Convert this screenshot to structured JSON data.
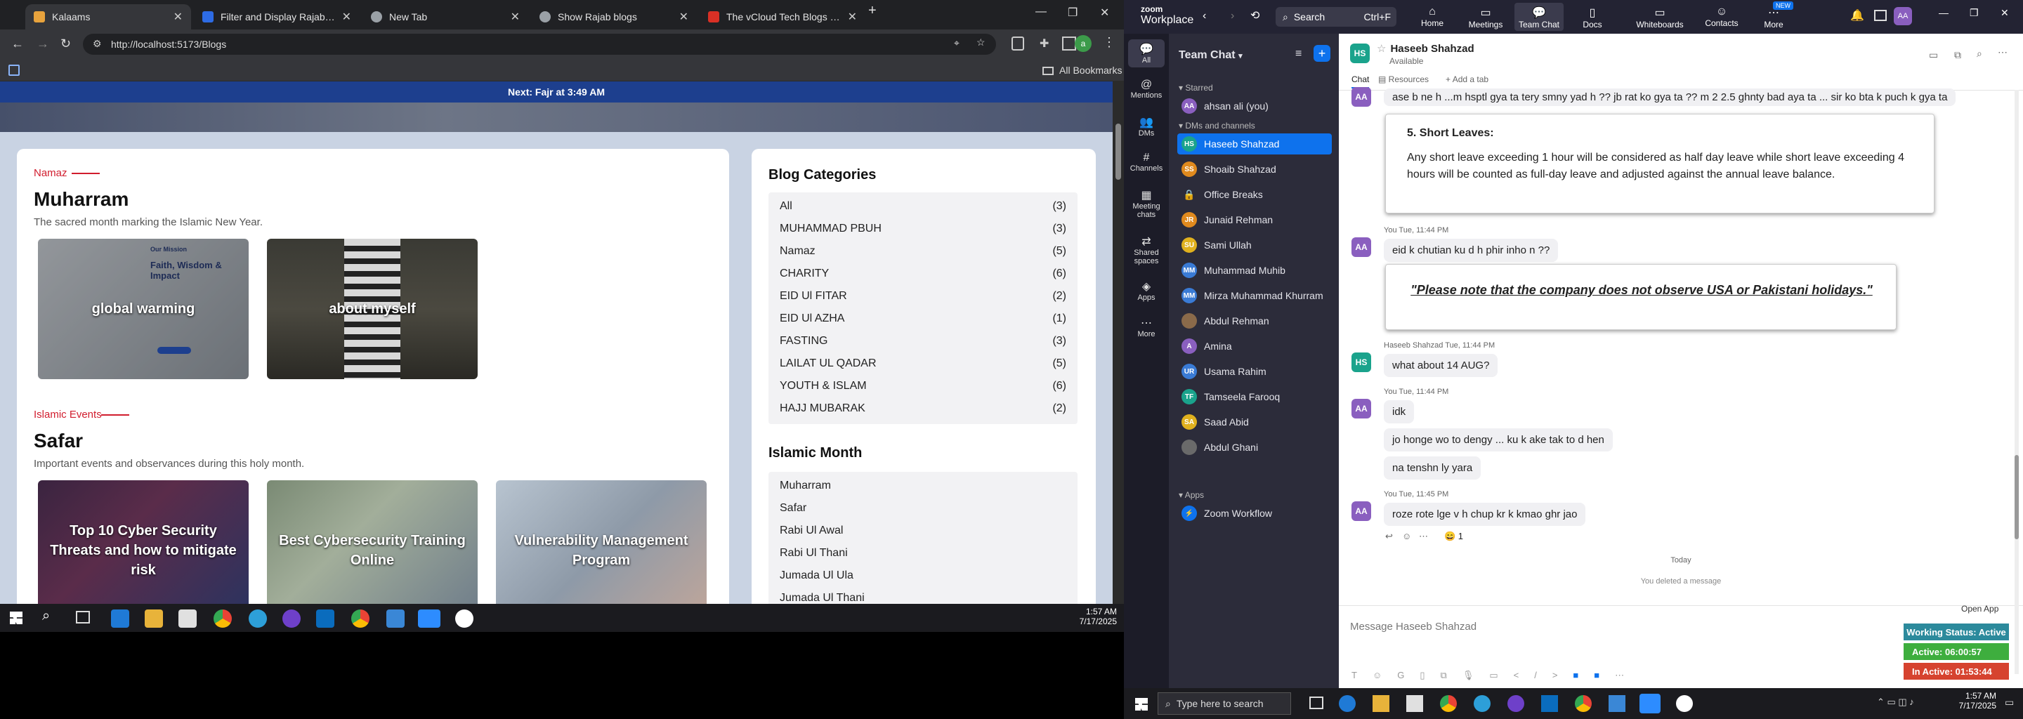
{
  "browser": {
    "tabs": [
      {
        "title": "Kalaams",
        "color": "#e8a33d",
        "active": true
      },
      {
        "title": "Filter and Display Rajab Blog Im",
        "color": "#2d6be4",
        "active": false
      },
      {
        "title": "New Tab",
        "color": "#9aa0a6",
        "active": false
      },
      {
        "title": "Show Rajab blogs",
        "color": "#9aa0a6",
        "active": false
      },
      {
        "title": "The vCloud Tech Blogs - vCloud",
        "color": "#d93025",
        "active": false
      }
    ],
    "url": "http://localhost:5173/Blogs",
    "all_bookmarks": "All Bookmarks"
  },
  "site": {
    "prayer_banner": "Next: Fajr at 3:49 AM",
    "sections": [
      {
        "label": "Namaz",
        "title": "Muharram",
        "desc": "The sacred month marking the Islamic New Year.",
        "posts": [
          "global warming",
          "about myself"
        ]
      },
      {
        "label": "Islamic Events",
        "title": "Safar",
        "desc": "Important events and observances during this holy month.",
        "posts": [
          "Top 10 Cyber Security Threats and how to mitigate risk",
          "Best Cybersecurity Training Online",
          "Vulnerability Management Program"
        ]
      }
    ],
    "thumb_caption": "Faith, Wisdom & Impact",
    "thumb_small": "Our Mission",
    "categories_title": "Blog Categories",
    "categories": [
      {
        "name": "All",
        "count": "(3)"
      },
      {
        "name": "MUHAMMAD PBUH",
        "count": "(3)"
      },
      {
        "name": "Namaz",
        "count": "(5)"
      },
      {
        "name": "CHARITY",
        "count": "(6)"
      },
      {
        "name": "EID Ul FITAR",
        "count": "(2)"
      },
      {
        "name": "EID Ul AZHA",
        "count": "(1)"
      },
      {
        "name": "FASTING",
        "count": "(3)"
      },
      {
        "name": "LAILAT UL QADAR",
        "count": "(5)"
      },
      {
        "name": "YOUTH & ISLAM",
        "count": "(6)"
      },
      {
        "name": "HAJJ MUBARAK",
        "count": "(2)"
      }
    ],
    "months_title": "Islamic Month",
    "months": [
      "Muharram",
      "Safar",
      "Rabi Ul Awal",
      "Rabi Ul Thani",
      "Jumada Ul Ula",
      "Jumada Ul Thani"
    ]
  },
  "left_taskbar": {
    "time": "1:57 AM",
    "date": "7/17/2025"
  },
  "zoom": {
    "brand_top": "zoom",
    "brand_bottom": "Workplace",
    "search": "Search",
    "search_shortcut": "Ctrl+F",
    "nav": [
      "Home",
      "Meetings",
      "Team Chat",
      "Docs",
      "Whiteboards",
      "Contacts",
      "More"
    ],
    "new_badge": "NEW",
    "rail": [
      "All",
      "Mentions",
      "DMs",
      "Channels",
      "Meeting chats",
      "Shared spaces",
      "Apps",
      "More"
    ],
    "sidebar_title": "Team Chat",
    "starred_label": "Starred",
    "starred": [
      {
        "name": "ahsan ali (you)",
        "initials": "AA",
        "color": "#8a5fbf"
      }
    ],
    "dms_label": "DMs and channels",
    "dms": [
      {
        "name": "Haseeb Shahzad",
        "initials": "HS",
        "color": "#1aa38c",
        "selected": true
      },
      {
        "name": "Shoaib Shahzad",
        "initials": "SS",
        "color": "#e08a1e"
      },
      {
        "name": "Office Breaks",
        "initials": "",
        "color": "#555"
      },
      {
        "name": "Junaid Rehman",
        "initials": "JR",
        "color": "#e08a1e"
      },
      {
        "name": "Sami Ullah",
        "initials": "SU",
        "color": "#e0b11e"
      },
      {
        "name": "Muhammad Muhib",
        "initials": "MM",
        "color": "#3a7bd5"
      },
      {
        "name": "Mirza Muhammad Khurram",
        "initials": "MM",
        "color": "#3a7bd5"
      },
      {
        "name": "Abdul Rehman",
        "initials": "",
        "color": "#8a6a4a"
      },
      {
        "name": "Amina",
        "initials": "A",
        "color": "#8a5fbf"
      },
      {
        "name": "Usama Rahim",
        "initials": "UR",
        "color": "#3a7bd5"
      },
      {
        "name": "Tamseela Farooq",
        "initials": "TF",
        "color": "#1aa38c"
      },
      {
        "name": "Saad Abid",
        "initials": "SA",
        "color": "#e0b11e"
      },
      {
        "name": "Abdul Ghani",
        "initials": "",
        "color": "#6a6a6a"
      }
    ],
    "apps_label": "Apps",
    "apps": [
      {
        "name": "Zoom Workflow"
      }
    ],
    "chat_header": {
      "initials": "HS",
      "name": "Haseeb Shahzad",
      "status": "Available",
      "tabs": [
        "Chat",
        "Resources",
        "Add a tab"
      ]
    },
    "messages": {
      "top_line": "ase b ne h ...m hsptl gya ta tery smny yad h ?? jb rat ko gya ta ?? m 2 2.5 ghnty bad aya ta ... sir ko bta k puch k gya ta",
      "leave_title": "5. Short Leaves:",
      "leave_body_1": "Any short leave exceeding 1 hour will be considered as half day leave while short leave exceeding 4",
      "leave_body_2": "hours will be counted as full-day leave and adjusted against the annual leave balance.",
      "meta1": "You Tue, 11:44 PM",
      "msg1": "eid k chutian ku d h phir inho n ??",
      "holiday_note": "\"Please note that the company does not observe USA or Pakistani holidays.\"",
      "meta2": "Haseeb Shahzad Tue, 11:44 PM",
      "msg2": "what about 14 AUG?",
      "meta3": "You Tue, 11:44 PM",
      "msg3": "idk",
      "msg4": "jo honge wo to dengy ... ku k ake tak to d hen",
      "msg5": "na tenshn ly yara",
      "meta4": "You Tue, 11:45 PM",
      "msg6": "roze rote lge v h chup kr k kmao ghr jao",
      "reaction": "😄 1",
      "today": "Today",
      "deleted": "You deleted a message"
    },
    "composer_placeholder": "Message Haseeb Shahzad",
    "open_app": "Open App",
    "work_status": {
      "working": "Working Status: Active",
      "active": "Active: 06:00:57",
      "inactive": "In Active: 01:53:44"
    },
    "avatar_initials": "AA"
  },
  "right_taskbar": {
    "search_placeholder": "Type here to search",
    "time": "1:57 AM",
    "date": "7/17/2025"
  }
}
